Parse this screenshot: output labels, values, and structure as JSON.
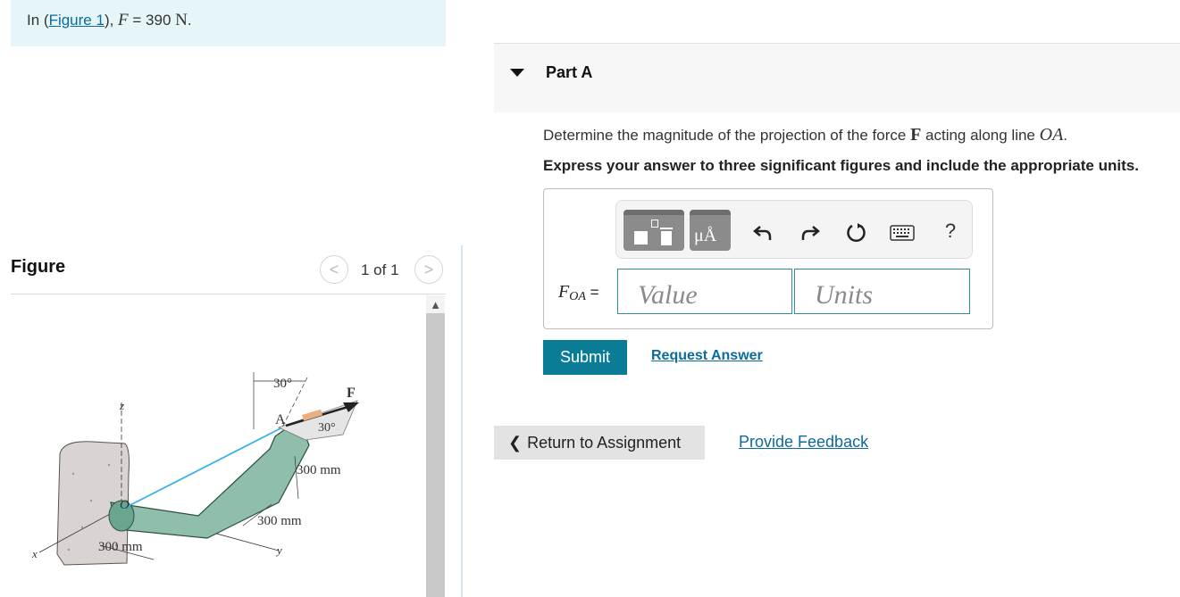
{
  "intro": {
    "prefix": "In (",
    "figure_link": "Figure 1",
    "suffix": "), ",
    "variable": "F",
    "equals": " = 390 ",
    "unit": "N",
    "period": "."
  },
  "figure_panel": {
    "title": "Figure",
    "pager_prev": "<",
    "pager_next": ">",
    "pager_count": "1 of 1",
    "labels": {
      "angle_top": "30°",
      "force": "F",
      "point_a": "A",
      "angle_side": "30°",
      "dim_vertical": "300 mm",
      "dim_diagonal": "300 mm",
      "dim_base": "300 mm",
      "origin": "O",
      "axis_z": "z",
      "axis_x": "x",
      "axis_y": "y"
    }
  },
  "part": {
    "title": "Part A",
    "question_prefix": "Determine the magnitude of the projection of the force ",
    "question_force": "F",
    "question_middle": " acting along line ",
    "question_line": "OA",
    "question_end": ".",
    "instruction": "Express your answer to three significant figures and include the appropriate units."
  },
  "answer": {
    "variable": "F",
    "subscript": "OA",
    "equals": " =",
    "value_placeholder": "Value",
    "units_placeholder": "Units",
    "units_button_label": "μÅ",
    "help_label": "?"
  },
  "actions": {
    "submit": "Submit",
    "request_answer": "Request Answer",
    "return_to_assignment": "Return to Assignment",
    "return_chevron": "❮",
    "provide_feedback": "Provide Feedback"
  },
  "colors": {
    "accent": "#0b7c96",
    "link": "#0b6b9e",
    "intro_bg": "#e6f6f8",
    "member_fill": "#8fbeaa",
    "projection_line": "#3ab0e8"
  }
}
